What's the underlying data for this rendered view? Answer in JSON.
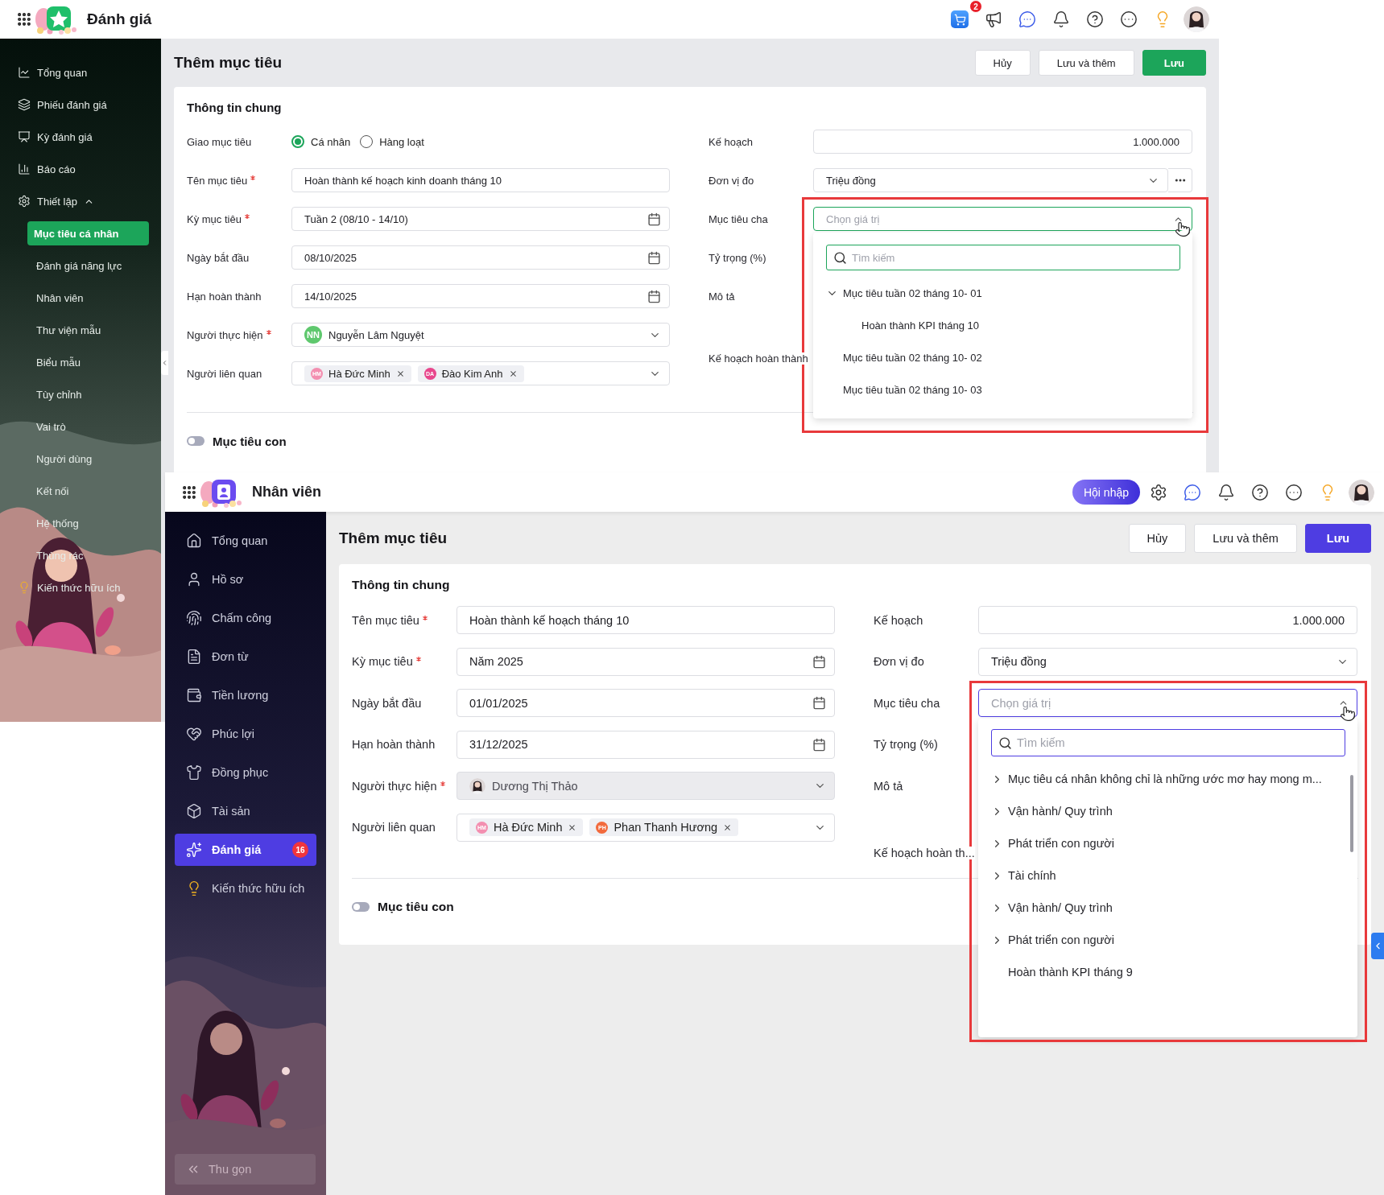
{
  "screens": [
    {
      "kind": "green",
      "header": {
        "title": "Đánh giá",
        "cart_badge": "2"
      },
      "sidebar": {
        "items": [
          {
            "label": "Tổng quan",
            "selected": false
          },
          {
            "label": "Phiếu đánh giá",
            "selected": false
          },
          {
            "label": "Kỳ đánh giá",
            "selected": false
          },
          {
            "label": "Báo cáo",
            "selected": false
          },
          {
            "label": "Thiết lập",
            "selected": false,
            "expanded": true,
            "children": [
              {
                "label": "Mục tiêu cá nhân",
                "selected": true
              },
              {
                "label": "Đánh giá năng lực",
                "selected": false
              },
              {
                "label": "Nhân viên",
                "selected": false
              },
              {
                "label": "Thư viện mẫu",
                "selected": false
              },
              {
                "label": "Biểu mẫu",
                "selected": false
              },
              {
                "label": "Tùy chỉnh",
                "selected": false
              },
              {
                "label": "Vai trò",
                "selected": false
              },
              {
                "label": "Người dùng",
                "selected": false
              },
              {
                "label": "Kết nối",
                "selected": false
              },
              {
                "label": "Hệ thống",
                "selected": false
              },
              {
                "label": "Thùng rác",
                "selected": false
              }
            ]
          },
          {
            "label": "Kiến thức hữu ích",
            "selected": false
          }
        ]
      },
      "page": {
        "title": "Thêm mục tiêu",
        "buttons": [
          {
            "label": "Hủy",
            "primary": false
          },
          {
            "label": "Lưu và thêm",
            "primary": false
          },
          {
            "label": "Lưu",
            "primary": true
          }
        ]
      },
      "form": {
        "title": "Thông tin chung",
        "left": [
          {
            "kind": "radio",
            "label": "Giao mục tiêu",
            "required": false,
            "options": [
              {
                "label": "Cá nhân",
                "selected": true
              },
              {
                "label": "Hàng loạt",
                "selected": false
              }
            ]
          },
          {
            "kind": "text",
            "label": "Tên mục tiêu",
            "required": true,
            "value": "Hoàn thành kế hoạch kinh doanh tháng 10"
          },
          {
            "kind": "date",
            "label": "Kỳ mục tiêu",
            "required": true,
            "value": "Tuần 2 (08/10 - 14/10)"
          },
          {
            "kind": "date",
            "label": "Ngày bắt đầu",
            "required": false,
            "value": "08/10/2025"
          },
          {
            "kind": "date",
            "label": "Hạn hoàn thành",
            "required": false,
            "value": "14/10/2025"
          },
          {
            "kind": "person",
            "label": "Người thực hiện",
            "required": true,
            "value": "Nguyễn Lâm Nguyệt",
            "initials": "NN",
            "color": "#5fc86e",
            "disabled": false
          },
          {
            "kind": "tags",
            "label": "Người liên quan",
            "required": false,
            "tags": [
              {
                "initials": "HM",
                "label": "Hà Đức Minh",
                "color": "#f38fb0"
              },
              {
                "initials": "DA",
                "label": "Đào Kim Anh",
                "color": "#e8468c"
              }
            ]
          }
        ],
        "right": [
          {
            "kind": "number",
            "label": "Kế hoạch",
            "value": "1.000.000"
          },
          {
            "kind": "select",
            "label": "Đơn vị đo",
            "value": "Triệu đồng",
            "more": true
          },
          {
            "kind": "parent",
            "label": "Mục tiêu cha",
            "placeholder": "Chọn giá trị",
            "highlighted": true
          },
          {
            "kind": "plain",
            "label": "Tỷ trọng (%)"
          },
          {
            "kind": "tall",
            "label": "Mô tả"
          },
          {
            "kind": "plain",
            "label": "Kế hoạch hoàn thành"
          }
        ],
        "toggle": {
          "label": "Mục tiêu con",
          "on": false
        }
      },
      "dropdown": {
        "search_placeholder": "Tìm kiếm",
        "items": [
          {
            "label": "Mục tiêu tuần 02 tháng 10- 01",
            "expandable": true,
            "expanded": true,
            "children": [
              {
                "label": "Hoàn thành KPI tháng 10",
                "expandable": false
              }
            ]
          },
          {
            "label": "Mục tiêu tuần 02 tháng 10- 02",
            "expandable": false
          },
          {
            "label": "Mục tiêu tuần 02 tháng 10- 03",
            "expandable": false
          }
        ]
      }
    },
    {
      "kind": "purple",
      "header": {
        "title": "Nhân viên",
        "action_button": "Hội nhập"
      },
      "sidebar": {
        "items": [
          {
            "label": "Tổng quan",
            "selected": false
          },
          {
            "label": "Hồ sơ",
            "selected": false
          },
          {
            "label": "Chấm công",
            "selected": false
          },
          {
            "label": "Đơn từ",
            "selected": false
          },
          {
            "label": "Tiền lương",
            "selected": false
          },
          {
            "label": "Phúc lợi",
            "selected": false
          },
          {
            "label": "Đồng phục",
            "selected": false
          },
          {
            "label": "Tài sản",
            "selected": false
          },
          {
            "label": "Đánh giá",
            "selected": true,
            "badge": "16"
          },
          {
            "label": "Kiến thức hữu ích",
            "selected": false
          }
        ],
        "collapse_label": "Thu gọn"
      },
      "page": {
        "title": "Thêm mục tiêu",
        "buttons": [
          {
            "label": "Hủy",
            "primary": false
          },
          {
            "label": "Lưu và thêm",
            "primary": false
          },
          {
            "label": "Lưu",
            "primary": true
          }
        ]
      },
      "form": {
        "title": "Thông tin chung",
        "left": [
          {
            "kind": "text",
            "label": "Tên mục tiêu",
            "required": true,
            "value": "Hoàn thành kế hoạch tháng 10"
          },
          {
            "kind": "date",
            "label": "Kỳ mục tiêu",
            "required": true,
            "value": "Năm 2025"
          },
          {
            "kind": "date",
            "label": "Ngày bắt đầu",
            "required": false,
            "value": "01/01/2025"
          },
          {
            "kind": "date",
            "label": "Hạn hoàn thành",
            "required": false,
            "value": "31/12/2025"
          },
          {
            "kind": "person",
            "label": "Người thực hiện",
            "required": true,
            "value": "Dương Thị Thảo",
            "disabled": true
          },
          {
            "kind": "tags",
            "label": "Người liên quan",
            "required": false,
            "tags": [
              {
                "initials": "HM",
                "label": "Hà Đức Minh",
                "color": "#f38fb0"
              },
              {
                "initials": "PH",
                "label": "Phan Thanh Hương",
                "color": "#f26a3d"
              }
            ]
          }
        ],
        "right": [
          {
            "kind": "number",
            "label": "Kế hoạch",
            "value": "1.000.000"
          },
          {
            "kind": "select",
            "label": "Đơn vị đo",
            "value": "Triệu đồng",
            "more": false
          },
          {
            "kind": "parent",
            "label": "Mục tiêu cha",
            "placeholder": "Chọn giá trị",
            "highlighted": true
          },
          {
            "kind": "plain",
            "label": "Tỷ trọng (%)"
          },
          {
            "kind": "tall",
            "label": "Mô tả"
          },
          {
            "kind": "plain",
            "label": "Kế hoạch hoàn th..."
          }
        ],
        "toggle": {
          "label": "Mục tiêu con",
          "on": false
        }
      },
      "dropdown": {
        "search_placeholder": "Tìm kiếm",
        "items": [
          {
            "label": "Mục tiêu cá nhân không chỉ là những ước mơ hay mong m...",
            "expandable": true,
            "expanded": false
          },
          {
            "label": "Vận hành/ Quy trình",
            "expandable": true,
            "expanded": false
          },
          {
            "label": "Phát triển con người",
            "expandable": true,
            "expanded": false
          },
          {
            "label": "Tài chính",
            "expandable": true,
            "expanded": false
          },
          {
            "label": "Vận hành/ Quy trình",
            "expandable": true,
            "expanded": false
          },
          {
            "label": "Phát triển con người",
            "expandable": true,
            "expanded": false
          },
          {
            "label": "Hoàn thành KPI tháng 9",
            "expandable": false
          }
        ]
      }
    }
  ]
}
